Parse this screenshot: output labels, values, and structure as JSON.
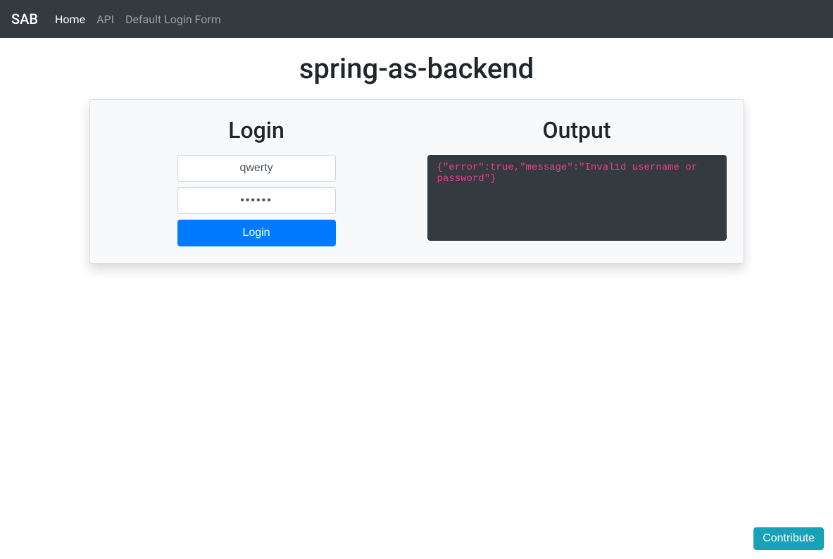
{
  "navbar": {
    "brand": "SAB",
    "links": [
      {
        "label": "Home",
        "active": true
      },
      {
        "label": "API",
        "active": false
      },
      {
        "label": "Default Login Form",
        "active": false
      }
    ]
  },
  "page": {
    "title": "spring-as-backend"
  },
  "login": {
    "heading": "Login",
    "username_value": "qwerty",
    "password_value": "••••••",
    "button_label": "Login"
  },
  "output": {
    "heading": "Output",
    "text": "{\"error\":true,\"message\":\"Invalid username or password\"}"
  },
  "footer": {
    "contribute_label": "Contribute"
  }
}
